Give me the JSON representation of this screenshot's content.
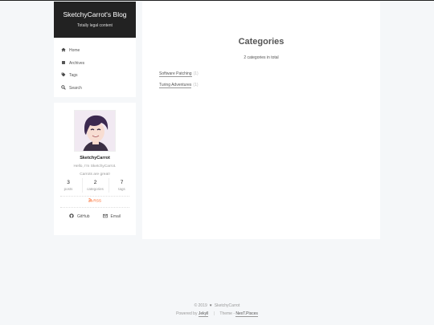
{
  "site": {
    "title": "SketchyCarrot's Blog",
    "subtitle": "Totally legal content"
  },
  "menu": [
    {
      "label": "Home",
      "icon": "home-icon"
    },
    {
      "label": "Archives",
      "icon": "archive-icon"
    },
    {
      "label": "Tags",
      "icon": "tags-icon"
    },
    {
      "label": "Search",
      "icon": "search-icon"
    }
  ],
  "profile": {
    "name": "SketchyCarrot",
    "description": "Hello, I'm SketchyCarrot.",
    "motto": "Carrots are great!",
    "stats": [
      {
        "count": "3",
        "label": "posts"
      },
      {
        "count": "2",
        "label": "categories"
      },
      {
        "count": "7",
        "label": "tags"
      }
    ],
    "rss": "RSS",
    "links": [
      {
        "label": "GitHub",
        "icon": "github-icon"
      },
      {
        "label": "Email",
        "icon": "envelope-icon"
      }
    ]
  },
  "main": {
    "title": "Categories",
    "count_text": "2 categories in total",
    "categories": [
      {
        "name": "Software Patching",
        "count": "(1)"
      },
      {
        "name": "Turing Adventures",
        "count": "(1)"
      }
    ]
  },
  "footer": {
    "copyright": "© 2019",
    "author": "SketchyCarrot",
    "powered_prefix": "Powered by",
    "powered_link": "Jekyll",
    "separator": "|",
    "theme_prefix": "Theme -",
    "theme_link": "NexT.Pisces"
  },
  "colors": {
    "accent": "#fc6423",
    "brand_bg": "#222222",
    "page_bg": "#f5f7f9"
  }
}
